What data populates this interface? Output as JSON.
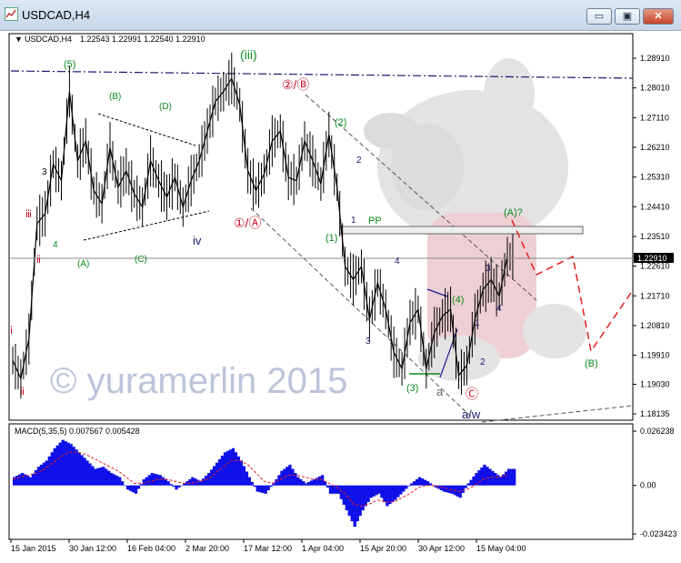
{
  "window": {
    "title": "USDCAD,H4",
    "minimize_glyph": "▭",
    "maximize_glyph": "▣",
    "close_glyph": "✕"
  },
  "chart_data": [
    {
      "type": "line",
      "symbol_label": "USDCAD,H4",
      "ohlc_label": "1.22543 1.22991 1.22540 1.22910",
      "symbol_glyph": "▼",
      "last_price": "1.22910",
      "y_ticks": [
        "1.28910",
        "1.28010",
        "1.27110",
        "1.26210",
        "1.25310",
        "1.24410",
        "1.23510",
        "1.22610",
        "1.21710",
        "1.20810",
        "1.19910",
        "1.19030",
        "1.18135"
      ],
      "ylim": [
        1.18135,
        1.2891
      ],
      "x_ticks": [
        "15 Jan 2015",
        "30 Jan 12:00",
        "16 Feb 04:00",
        "2 Mar 20:00",
        "17 Mar 12:00",
        "1 Apr 04:00",
        "15 Apr 20:00",
        "30 Apr 12:00",
        "15 May 04:00"
      ],
      "series": [
        {
          "x": [
            "15 Jan",
            "18 Jan",
            "20 Jan",
            "22 Jan",
            "24 Jan",
            "26 Jan",
            "28 Jan",
            "30 Jan",
            "1 Feb",
            "3 Feb",
            "5 Feb",
            "7 Feb",
            "9 Feb",
            "11 Feb",
            "13 Feb",
            "15 Feb",
            "17 Feb",
            "19 Feb",
            "21 Feb",
            "23 Feb",
            "25 Feb",
            "27 Feb",
            "1 Mar",
            "3 Mar",
            "5 Mar",
            "7 Mar",
            "9 Mar",
            "11 Mar",
            "13 Mar",
            "15 Mar",
            "17 Mar",
            "19 Mar",
            "21 Mar",
            "23 Mar",
            "25 Mar",
            "27 Mar",
            "29 Mar",
            "31 Mar",
            "2 Apr",
            "4 Apr",
            "6 Apr",
            "8 Apr",
            "10 Apr",
            "12 Apr",
            "14 Apr",
            "16 Apr",
            "18 Apr",
            "20 Apr",
            "22 Apr",
            "24 Apr",
            "26 Apr",
            "28 Apr",
            "30 Apr",
            "2 May",
            "4 May",
            "6 May",
            "8 May",
            "10 May",
            "12 May",
            "14 May",
            "16 May",
            "18 May"
          ],
          "values": [
            1.1975,
            1.192,
            1.204,
            1.239,
            1.242,
            1.257,
            1.252,
            1.279,
            1.258,
            1.264,
            1.249,
            1.245,
            1.262,
            1.25,
            1.255,
            1.248,
            1.244,
            1.258,
            1.252,
            1.247,
            1.253,
            1.244,
            1.252,
            1.258,
            1.267,
            1.276,
            1.279,
            1.283,
            1.275,
            1.255,
            1.249,
            1.254,
            1.264,
            1.267,
            1.253,
            1.252,
            1.264,
            1.258,
            1.251,
            1.266,
            1.25,
            1.226,
            1.222,
            1.226,
            1.21,
            1.221,
            1.213,
            1.2,
            1.195,
            1.209,
            1.213,
            1.195,
            1.206,
            1.211,
            1.213,
            1.193,
            1.196,
            1.21,
            1.219,
            1.222,
            1.217,
            1.229
          ]
        }
      ],
      "annotations": [
        "(iii)",
        "(5)",
        "(B)",
        "(D)",
        "3",
        "4",
        "(A)",
        "(C)",
        "iv",
        "ⅲ",
        "ⅱ",
        "ⅰ",
        "ⅱ",
        "②/Ⓑ",
        "①/Ⓐ",
        "(2)",
        "2",
        "1",
        "(1)",
        "PP",
        "4",
        "3",
        "(4)",
        "1",
        "2",
        "(3)",
        "a",
        "Ⓒ",
        "a/w",
        "(A)?",
        "3",
        "4",
        "(B)"
      ],
      "watermark": "© yuramerlin 2015"
    },
    {
      "type": "bar",
      "title": "MACD(5,35,5) 0.007567 0.005428",
      "y_ticks": [
        "0.026238",
        "0.00",
        "-0.023423"
      ],
      "ylim": [
        -0.023423,
        0.026238
      ],
      "series": [
        {
          "name": "MACD",
          "values": [
            0.004,
            0.006,
            0.004,
            0.009,
            0.012,
            0.018,
            0.022,
            0.02,
            0.016,
            0.012,
            0.008,
            0.009,
            0.006,
            0.004,
            -0.002,
            -0.004,
            0.003,
            0.006,
            0.005,
            0.002,
            -0.002,
            0.001,
            0.004,
            0.002,
            0.006,
            0.011,
            0.016,
            0.018,
            0.012,
            0.004,
            -0.003,
            -0.004,
            0.001,
            0.007,
            0.01,
            0.004,
            0.001,
            0.003,
            0.005,
            -0.004,
            -0.004,
            -0.012,
            -0.02,
            -0.012,
            -0.006,
            -0.004,
            -0.01,
            -0.007,
            -0.003,
            0.001,
            0.004,
            0.002,
            -0.001,
            -0.003,
            -0.004,
            -0.006,
            0.001,
            0.006,
            0.01,
            0.007,
            0.004,
            0.008
          ]
        },
        {
          "name": "Signal",
          "values": [
            0.003,
            0.004,
            0.005,
            0.006,
            0.008,
            0.011,
            0.014,
            0.016,
            0.016,
            0.015,
            0.013,
            0.011,
            0.009,
            0.007,
            0.004,
            0.001,
            0.001,
            0.002,
            0.003,
            0.003,
            0.002,
            0.001,
            0.001,
            0.002,
            0.003,
            0.006,
            0.009,
            0.012,
            0.012,
            0.01,
            0.006,
            0.002,
            0.001,
            0.003,
            0.005,
            0.005,
            0.004,
            0.003,
            0.003,
            0.001,
            -0.001,
            -0.004,
            -0.009,
            -0.01,
            -0.009,
            -0.007,
            -0.008,
            -0.008,
            -0.006,
            -0.004,
            -0.001,
            0.0,
            0.0,
            -0.001,
            -0.002,
            -0.003,
            -0.002,
            0.0,
            0.003,
            0.004,
            0.004,
            0.005
          ]
        }
      ]
    }
  ]
}
